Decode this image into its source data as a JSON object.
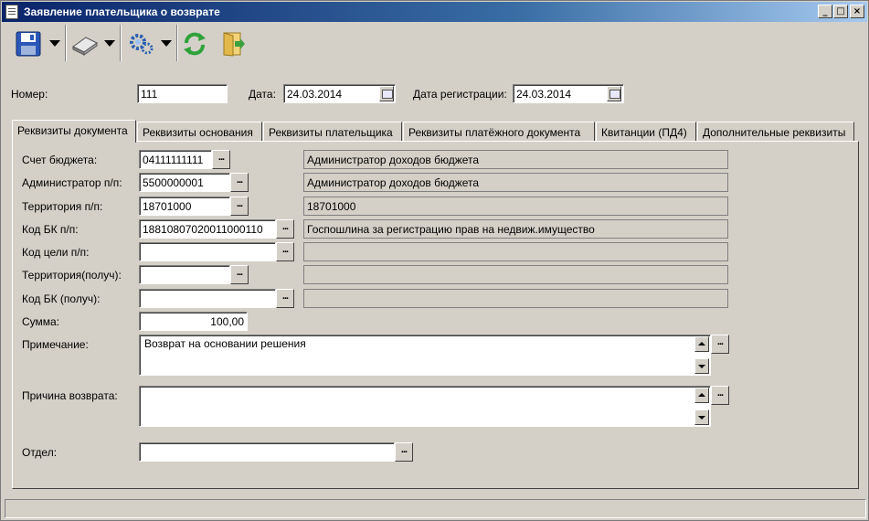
{
  "window": {
    "title": "Заявление плательщика о возврате",
    "minimize": "_",
    "maximize": "□",
    "close": "×"
  },
  "toolbar": {
    "icons": [
      "save-icon",
      "print-icon",
      "settings-icon",
      "refresh-icon",
      "exit-icon"
    ]
  },
  "header": {
    "number_label": "Номер:",
    "number_value": "111",
    "date_label": "Дата:",
    "date_value": "24.03.2014",
    "reg_date_label": "Дата регистрации:",
    "reg_date_value": "24.03.2014"
  },
  "tabs": [
    {
      "label": "Реквизиты документа",
      "active": true
    },
    {
      "label": "Реквизиты основания",
      "active": false
    },
    {
      "label": "Реквизиты плательщика",
      "active": false
    },
    {
      "label": "Реквизиты платёжного документа",
      "active": false
    },
    {
      "label": "Квитанции (ПД4)",
      "active": false
    },
    {
      "label": "Дополнительные реквизиты",
      "active": false
    }
  ],
  "form": {
    "dots": "...",
    "budget_account": {
      "label": "Счет бюджета:",
      "value": "04111111111",
      "description": "Администратор доходов бюджета"
    },
    "administrator": {
      "label": "Администратор п/п:",
      "value": "5500000001",
      "description": "Администратор доходов бюджета"
    },
    "territory": {
      "label": "Территория п/п:",
      "value": "18701000",
      "description": "18701000"
    },
    "kbk": {
      "label": "Код БК п/п:",
      "value": "18810807020011000110",
      "description": "Госпошлина за регистрацию прав на недвиж.имущество"
    },
    "purpose_code": {
      "label": "Код цели п/п:",
      "value": "",
      "description": ""
    },
    "territory_recv": {
      "label": "Территория(получ):",
      "value": "",
      "description": ""
    },
    "kbk_recv": {
      "label": "Код БК (получ):",
      "value": "",
      "description": ""
    },
    "amount": {
      "label": "Сумма:",
      "value": "100,00"
    },
    "note": {
      "label": "Примечание:",
      "value": "Возврат на основании решения"
    },
    "reason": {
      "label": "Причина возврата:",
      "value": ""
    },
    "department": {
      "label": "Отдел:",
      "value": ""
    }
  }
}
